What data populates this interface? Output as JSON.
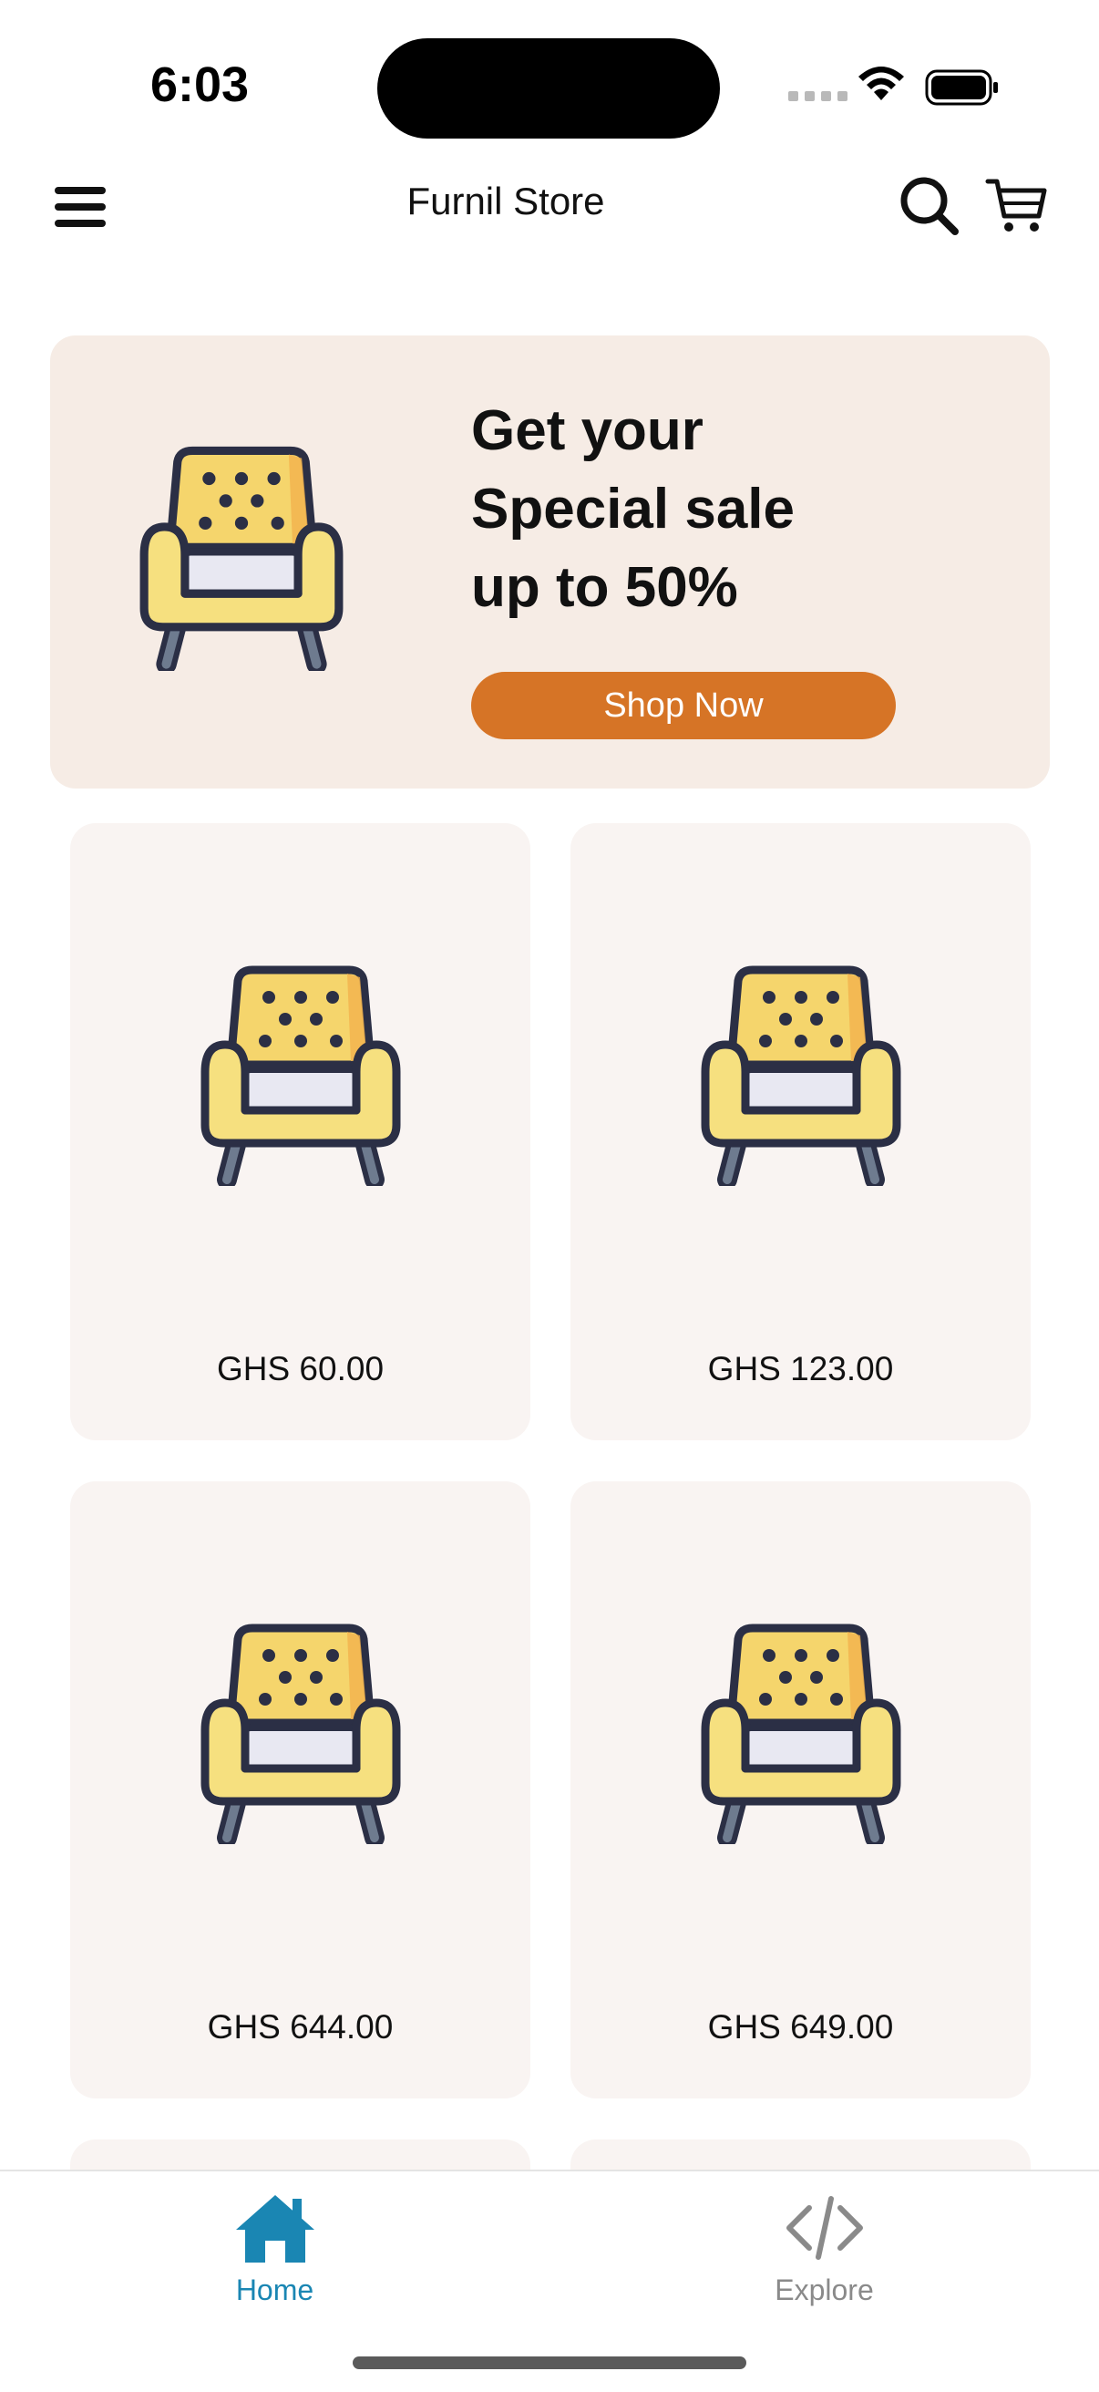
{
  "status_bar": {
    "time": "6:03"
  },
  "app_bar": {
    "title": "Furnil Store"
  },
  "promo": {
    "title_lines": [
      "Get your",
      "Special sale",
      "up to 50%"
    ],
    "button_label": "Shop Now",
    "button_color": "#d67426",
    "background_color": "#f6ece5"
  },
  "products": [
    {
      "price": "GHS 60.00",
      "icon": "armchair-icon"
    },
    {
      "price": "GHS 123.00",
      "icon": "armchair-icon"
    },
    {
      "price": "GHS 644.00",
      "icon": "armchair-icon"
    },
    {
      "price": "GHS 649.00",
      "icon": "armchair-icon"
    }
  ],
  "bottom_nav": {
    "items": [
      {
        "label": "Home",
        "icon": "home-icon",
        "active": true
      },
      {
        "label": "Explore",
        "icon": "code-icon",
        "active": false
      }
    ],
    "active_color": "#1a86b3",
    "inactive_color": "#8a8a8a"
  }
}
